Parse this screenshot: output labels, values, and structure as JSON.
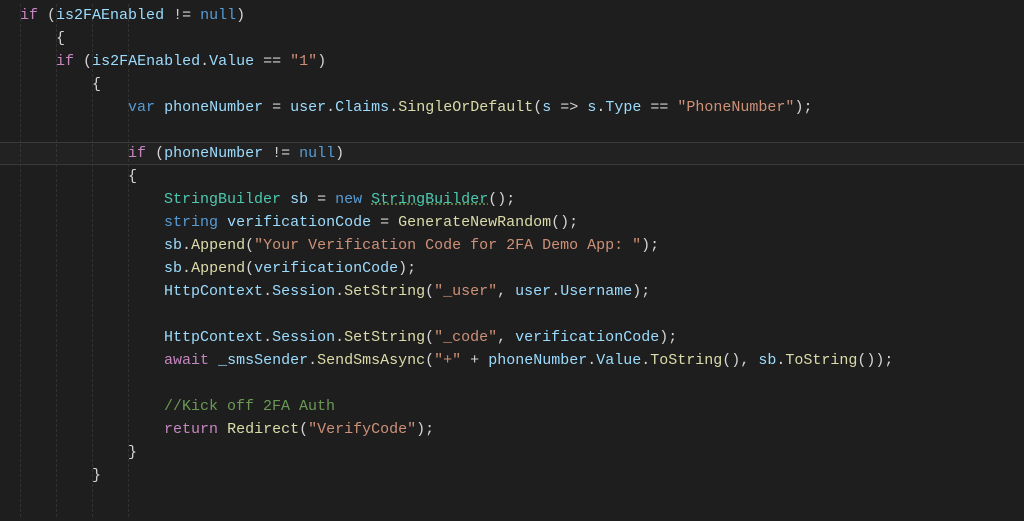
{
  "code": {
    "line1": {
      "if": "if",
      "open": "(",
      "var": "is2FAEnabled",
      "neq": "!=",
      "null": "null",
      "close": ")"
    },
    "line2": {
      "brace": "{"
    },
    "line3": {
      "if": "if",
      "open": "(",
      "var": "is2FAEnabled",
      "dot": ".",
      "prop": "Value",
      "eq": "==",
      "str": "\"1\"",
      "close": ")"
    },
    "line4": {
      "brace": "{"
    },
    "line5": {
      "kvar": "var",
      "name": "phoneNumber",
      "assign": "=",
      "user": "user",
      "claims": "Claims",
      "single": "SingleOrDefault",
      "p1": "(",
      "s": "s",
      "arrow": "=>",
      "s2": "s",
      "type": "Type",
      "eq": "==",
      "str": "\"PhoneNumber\"",
      "close": ");"
    },
    "line7": {
      "if": "if",
      "open": "(",
      "var": "phoneNumber",
      "neq": "!=",
      "null": "null",
      "close": ")"
    },
    "line8": {
      "brace": "{"
    },
    "line9": {
      "type1": "StringBuilder",
      "sb": "sb",
      "assign": "=",
      "new": "new",
      "type2": "StringBuilder",
      "tail": "();"
    },
    "line10": {
      "kw": "string",
      "name": "verificationCode",
      "assign": "=",
      "fn": "GenerateNewRandom",
      "tail": "();"
    },
    "line11": {
      "sb": "sb",
      "append": "Append",
      "str": "\"Your Verification Code for 2FA Demo App: \"",
      "tail": ");"
    },
    "line12": {
      "sb": "sb",
      "append": "Append",
      "arg": "verificationCode",
      "tail": ");"
    },
    "line13": {
      "http": "HttpContext",
      "session": "Session",
      "set": "SetString",
      "str": "\"_user\"",
      "user": "user",
      "uname": "Username",
      "tail": ");"
    },
    "line15": {
      "http": "HttpContext",
      "session": "Session",
      "set": "SetString",
      "str": "\"_code\"",
      "arg": "verificationCode",
      "tail": ");"
    },
    "line16": {
      "await": "await",
      "sender": "_smsSender",
      "send": "SendSmsAsync",
      "plus": "\"+\"",
      "concat": "+",
      "pn": "phoneNumber",
      "val": "Value",
      "tostr": "ToString",
      "parens1": "()",
      "sb": "sb",
      "tail": "());"
    },
    "line18": {
      "comment": "//Kick off 2FA Auth"
    },
    "line19": {
      "return": "return",
      "redirect": "Redirect",
      "str": "\"VerifyCode\"",
      "tail": ");"
    },
    "line20": {
      "brace": "}"
    },
    "line21": {
      "brace": "}"
    }
  }
}
